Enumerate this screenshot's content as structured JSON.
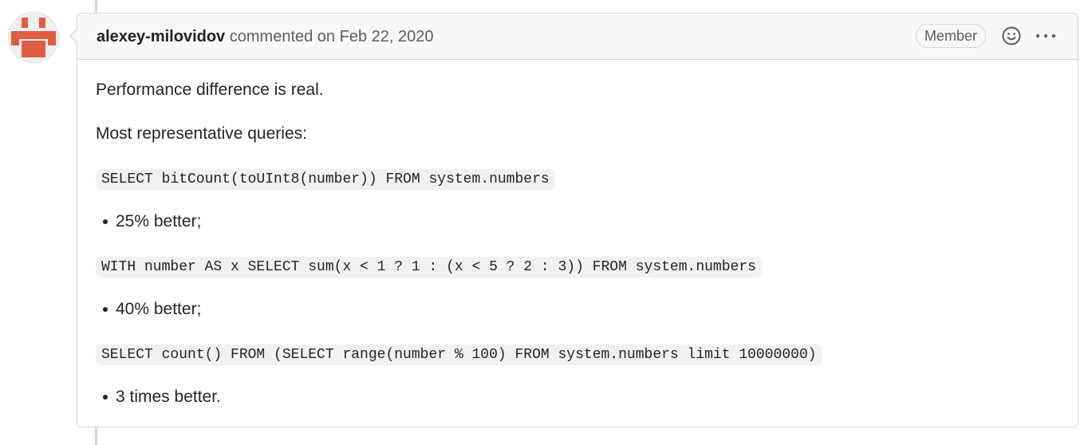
{
  "comment": {
    "author": "alexey-milovidov",
    "action_text": "commented on Feb 22, 2020",
    "role_badge": "Member",
    "emoji_icon": "smiley-icon",
    "more_icon": "kebab-horizontal-icon",
    "avatar_color": "#e05d44",
    "body": {
      "p1": "Performance difference is real.",
      "p2": "Most representative queries:",
      "queries": [
        {
          "sql": "SELECT bitCount(toUInt8(number)) FROM system.numbers",
          "result": "25% better;"
        },
        {
          "sql": "WITH number AS x SELECT sum(x < 1 ? 1 : (x < 5 ? 2 : 3)) FROM system.numbers",
          "result": "40% better;"
        },
        {
          "sql": "SELECT count() FROM (SELECT range(number % 100) FROM system.numbers limit 10000000)",
          "result": "3 times better."
        }
      ]
    }
  }
}
